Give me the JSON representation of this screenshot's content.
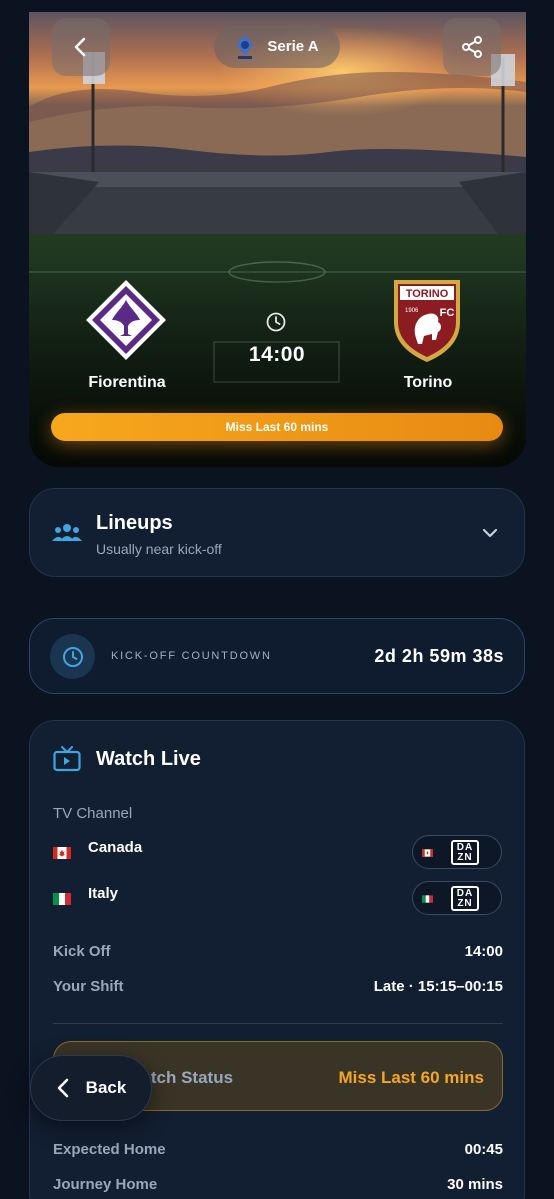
{
  "hero": {
    "league": "Serie A",
    "home_team": "Fiorentina",
    "away_team": "Torino",
    "kick_time": "14:00",
    "status_bar": "Miss Last 60 mins",
    "away_badge_text": "TORINO",
    "away_badge_year": "1906",
    "away_badge_fc": "FC"
  },
  "lineups": {
    "title": "Lineups",
    "subtitle": "Usually near kick-off"
  },
  "countdown": {
    "label": "KICK-OFF COUNTDOWN",
    "value": "2d 2h 59m 38s"
  },
  "watch": {
    "title": "Watch Live",
    "tv_channel_label": "TV Channel",
    "channels": [
      {
        "country": "Canada",
        "provider": "DAZN"
      },
      {
        "country": "Italy",
        "provider": "DAZN"
      }
    ],
    "kick_off_label": "Kick Off",
    "kick_off_value": "14:00",
    "shift_label": "Your Shift",
    "shift_value": "Late · 15:15–00:15",
    "status_label": "Watch Status",
    "status_value": "Miss Last 60 mins",
    "expected_home_label": "Expected Home",
    "expected_home_value": "00:45",
    "journey_home_label": "Journey Home",
    "journey_home_value": "30 mins"
  },
  "float_back": {
    "label": "Back"
  },
  "colors": {
    "accent_orange": "#f6a81c",
    "background": "#0b1220",
    "card": "#121e31",
    "fiorentina_purple": "#5b2a86",
    "torino_maroon": "#8b1c22"
  },
  "icons": [
    "back-icon",
    "share-icon",
    "serie-a-logo",
    "clock-icon",
    "people-icon",
    "chevron-down-icon",
    "tv-icon",
    "canada-flag-icon",
    "italy-flag-icon",
    "dazn-logo"
  ]
}
